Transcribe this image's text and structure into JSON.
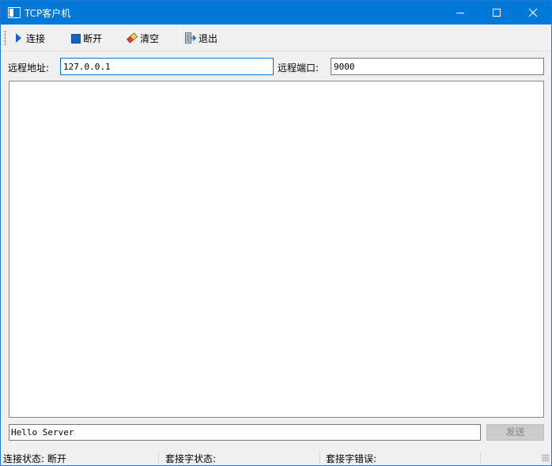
{
  "window": {
    "title": "TCP客户机"
  },
  "toolbar": {
    "connect_label": "连接",
    "disconnect_label": "断开",
    "clear_label": "清空",
    "quit_label": "退出"
  },
  "address_row": {
    "remote_addr_label": "远程地址:",
    "remote_addr_value": "127.0.0.1",
    "remote_port_label": "远程端口:",
    "remote_port_value": "9000"
  },
  "message": {
    "input_value": "Hello Server",
    "send_label": "发送"
  },
  "status_bar": {
    "connection_status": "连接状态: 断开",
    "socket_status": "套接字状态:",
    "socket_error": "套接字错误:"
  },
  "colors": {
    "titlebar": "#0078d7",
    "accent": "#1565c0"
  }
}
